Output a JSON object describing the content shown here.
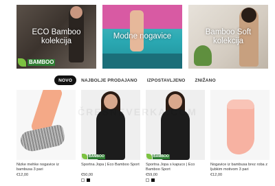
{
  "banners": [
    {
      "title": "ECO Bamboo kolekcija",
      "logo_text": "BAMBOO"
    },
    {
      "title": "Modne nogavice"
    },
    {
      "title": "Bamboo Soft kolekcija"
    }
  ],
  "tabs": [
    {
      "label": "NOVO",
      "active": true
    },
    {
      "label": "NAJBOLJE PRODAJANO",
      "active": false
    },
    {
      "label": "IZPOSTAVLJENO",
      "active": false
    },
    {
      "label": "ZNIŽANO",
      "active": false
    }
  ],
  "watermark": "ČRESNEVERKA.COM",
  "products": [
    {
      "name": "Nizke mehke nogavice iz bambusa 3 pari",
      "price": "€12,00",
      "logo_text": ""
    },
    {
      "name": "Športna Jopa | Eco Bamboo Sport",
      "price": "€50,00",
      "logo_text": "BAMBOO"
    },
    {
      "name": "Športna Jopa s kapuco | Eco Bamboo Sport",
      "price": "€59,00",
      "logo_text": "BAMBOO"
    },
    {
      "name": "Nogavice iz bambusa brez roba z ljubkim motivom 3 pari",
      "price": "€12,00",
      "logo_text": ""
    }
  ],
  "colors": {
    "accent": "#111111",
    "eco_green": "#7cc241"
  }
}
